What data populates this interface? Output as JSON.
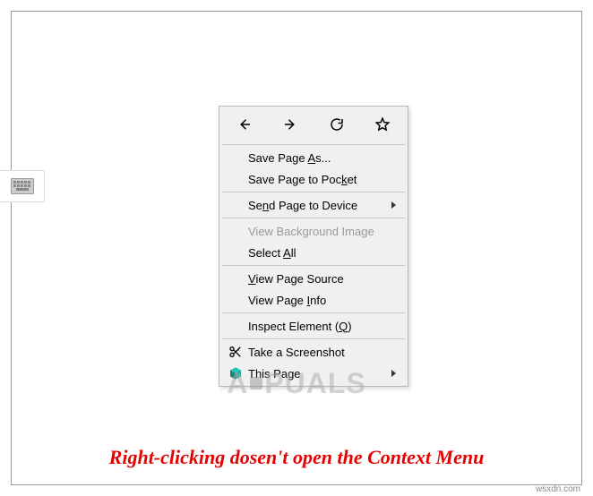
{
  "context_menu": {
    "nav": {
      "back": "back-arrow",
      "forward": "forward-arrow",
      "reload": "reload",
      "bookmark": "star-outline"
    },
    "items": [
      {
        "label_html": "Save Page <u>A</u>s...",
        "icon": null,
        "submenu": false,
        "enabled": true
      },
      {
        "label_html": "Save Page to Poc<u>k</u>et",
        "icon": null,
        "submenu": false,
        "enabled": true
      },
      {
        "sep": true
      },
      {
        "label_html": "Se<u>n</u>d Page to Device",
        "icon": null,
        "submenu": true,
        "enabled": true
      },
      {
        "sep": true
      },
      {
        "label_html": "View Background Image",
        "icon": null,
        "submenu": false,
        "enabled": false
      },
      {
        "label_html": "Select <u>A</u>ll",
        "icon": null,
        "submenu": false,
        "enabled": true
      },
      {
        "sep": true
      },
      {
        "label_html": "<u>V</u>iew Page Source",
        "icon": null,
        "submenu": false,
        "enabled": true
      },
      {
        "label_html": "View Page <u>I</u>nfo",
        "icon": null,
        "submenu": false,
        "enabled": true
      },
      {
        "sep": true
      },
      {
        "label_html": "Inspect Element (<u>Q</u>)",
        "icon": null,
        "submenu": false,
        "enabled": true
      },
      {
        "sep": true
      },
      {
        "label_html": "Take a Screenshot",
        "icon": "scissors",
        "submenu": false,
        "enabled": true
      },
      {
        "label_html": "This Page",
        "icon": "cube-teal",
        "submenu": true,
        "enabled": true
      }
    ]
  },
  "caption": "Right-clicking dosen't open the Context Menu",
  "watermark": "A PUALS",
  "attrib": "wsxdn.com"
}
